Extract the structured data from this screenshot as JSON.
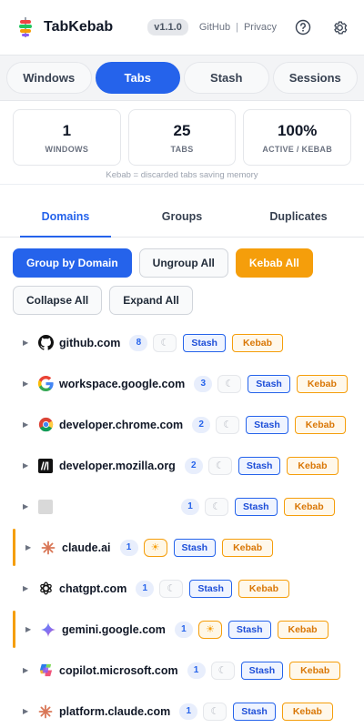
{
  "header": {
    "app_title": "TabKebab",
    "version": "v1.1.0",
    "github_label": "GitHub",
    "separator": "|",
    "privacy_label": "Privacy"
  },
  "modes": [
    "Windows",
    "Tabs",
    "Stash",
    "Sessions"
  ],
  "active_mode": "Tabs",
  "stats": [
    {
      "value": "1",
      "label": "WINDOWS"
    },
    {
      "value": "25",
      "label": "TABS"
    },
    {
      "value": "100%",
      "label": "ACTIVE / KEBAB"
    }
  ],
  "note": "Kebab = discarded tabs saving memory",
  "subtabs": [
    "Domains",
    "Groups",
    "Duplicates"
  ],
  "active_subtab": "Domains",
  "actions": {
    "group_by_domain": "Group by Domain",
    "ungroup_all": "Ungroup All",
    "kebab_all": "Kebab All",
    "collapse_all": "Collapse All",
    "expand_all": "Expand All"
  },
  "row_labels": {
    "stash": "Stash",
    "kebab": "Kebab",
    "caret": "▶",
    "moon": "☾",
    "sun": "☀"
  },
  "domains": [
    {
      "name": "github.com",
      "count": "8",
      "state": "moon",
      "accent": false,
      "icon": "github-icon"
    },
    {
      "name": "workspace.google.com",
      "count": "3",
      "state": "moon",
      "accent": false,
      "icon": "google-icon"
    },
    {
      "name": "developer.chrome.com",
      "count": "2",
      "state": "moon",
      "accent": false,
      "icon": "chrome-icon"
    },
    {
      "name": "developer.mozilla.org",
      "count": "2",
      "state": "moon",
      "accent": false,
      "icon": "mdn-icon"
    },
    {
      "name": "",
      "count": "1",
      "state": "moon",
      "accent": false,
      "icon": "blank-favicon-icon"
    },
    {
      "name": "claude.ai",
      "count": "1",
      "state": "sun",
      "accent": true,
      "icon": "claude-icon"
    },
    {
      "name": "chatgpt.com",
      "count": "1",
      "state": "moon",
      "accent": false,
      "icon": "chatgpt-icon"
    },
    {
      "name": "gemini.google.com",
      "count": "1",
      "state": "sun",
      "accent": true,
      "icon": "gemini-icon"
    },
    {
      "name": "copilot.microsoft.com",
      "count": "1",
      "state": "moon",
      "accent": false,
      "icon": "copilot-icon"
    },
    {
      "name": "platform.claude.com",
      "count": "1",
      "state": "moon",
      "accent": false,
      "icon": "claude-icon"
    }
  ],
  "colors": {
    "accent": "#2563eb",
    "kebab": "#f59e0b"
  }
}
